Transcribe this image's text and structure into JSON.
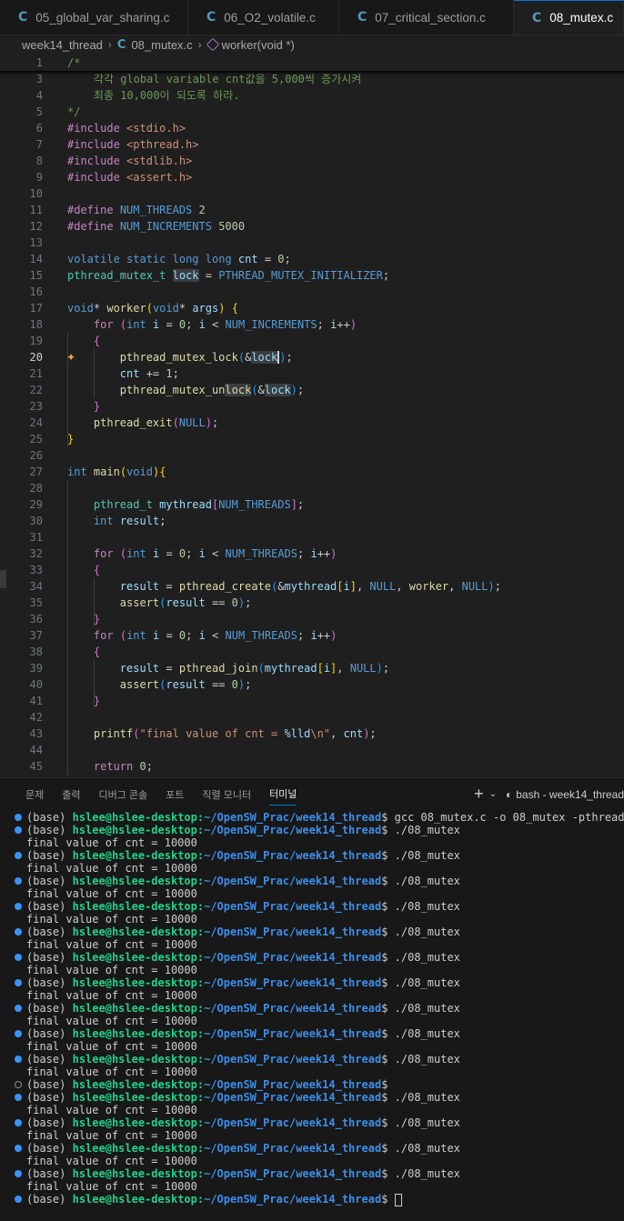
{
  "tabs": [
    {
      "label": "05_global_var_sharing.c"
    },
    {
      "label": "06_O2_volatile.c"
    },
    {
      "label": "07_critical_section.c"
    },
    {
      "label": "08_mutex.c"
    }
  ],
  "tab_icon_glyph": "C",
  "breadcrumb": {
    "folder": "week14_thread",
    "file": "08_mutex.c",
    "symbol": "worker(void *)"
  },
  "editor": {
    "line_numbers": [
      "1",
      "3",
      "4",
      "5",
      "6",
      "7",
      "8",
      "9",
      "10",
      "11",
      "12",
      "13",
      "14",
      "15",
      "16",
      "17",
      "18",
      "19",
      "20",
      "21",
      "22",
      "23",
      "24",
      "25",
      "26",
      "27",
      "28",
      "29",
      "30",
      "31",
      "32",
      "33",
      "34",
      "35",
      "36",
      "37",
      "38",
      "39",
      "40",
      "41",
      "42",
      "43",
      "44",
      "45"
    ],
    "current_line": "20"
  },
  "panel": {
    "tabs": [
      "문제",
      "출력",
      "디버그 콘솔",
      "포트",
      "직렬 모니터",
      "터미널"
    ],
    "active_tab": "터미널",
    "add_icon": "+",
    "shell_label": "bash - week14_thread"
  },
  "terminal": {
    "env": "(base)",
    "user": "hslee@hslee-desktop",
    "path": "~/OpenSW_Prac/week14_thread",
    "lines": [
      {
        "type": "prompt",
        "cmd": "gcc 08_mutex.c -o 08_mutex -pthread"
      },
      {
        "type": "prompt",
        "cmd": "./08_mutex"
      },
      {
        "type": "output",
        "text": "final value of cnt = 10000"
      },
      {
        "type": "prompt",
        "cmd": "./08_mutex"
      },
      {
        "type": "output",
        "text": "final value of cnt = 10000"
      },
      {
        "type": "prompt",
        "cmd": "./08_mutex"
      },
      {
        "type": "output",
        "text": "final value of cnt = 10000"
      },
      {
        "type": "prompt",
        "cmd": "./08_mutex"
      },
      {
        "type": "output",
        "text": "final value of cnt = 10000"
      },
      {
        "type": "prompt",
        "cmd": "./08_mutex"
      },
      {
        "type": "output",
        "text": "final value of cnt = 10000"
      },
      {
        "type": "prompt",
        "cmd": "./08_mutex"
      },
      {
        "type": "output",
        "text": "final value of cnt = 10000"
      },
      {
        "type": "prompt",
        "cmd": "./08_mutex"
      },
      {
        "type": "output",
        "text": "final value of cnt = 10000"
      },
      {
        "type": "prompt",
        "cmd": "./08_mutex"
      },
      {
        "type": "output",
        "text": "final value of cnt = 10000"
      },
      {
        "type": "prompt",
        "cmd": "./08_mutex"
      },
      {
        "type": "output",
        "text": "final value of cnt = 10000"
      },
      {
        "type": "prompt",
        "cmd": "./08_mutex"
      },
      {
        "type": "output",
        "text": "final value of cnt = 10000"
      },
      {
        "type": "prompt_empty",
        "cmd": ""
      },
      {
        "type": "prompt",
        "cmd": "./08_mutex"
      },
      {
        "type": "output",
        "text": "final value of cnt = 10000"
      },
      {
        "type": "prompt",
        "cmd": "./08_mutex"
      },
      {
        "type": "output",
        "text": "final value of cnt = 10000"
      },
      {
        "type": "prompt",
        "cmd": "./08_mutex"
      },
      {
        "type": "output",
        "text": "final value of cnt = 10000"
      },
      {
        "type": "prompt",
        "cmd": "./08_mutex"
      },
      {
        "type": "output",
        "text": "final value of cnt = 10000"
      },
      {
        "type": "prompt_cursor",
        "cmd": ""
      }
    ]
  },
  "colors": {
    "accent": "#0078d4",
    "editor_bg": "#1f1f1f",
    "panel_bg": "#181818",
    "keyword": "#569cd6",
    "preprocessor": "#c586c0",
    "string": "#ce9178",
    "terminal_user": "#23d18b",
    "terminal_path": "#3b8eea"
  }
}
